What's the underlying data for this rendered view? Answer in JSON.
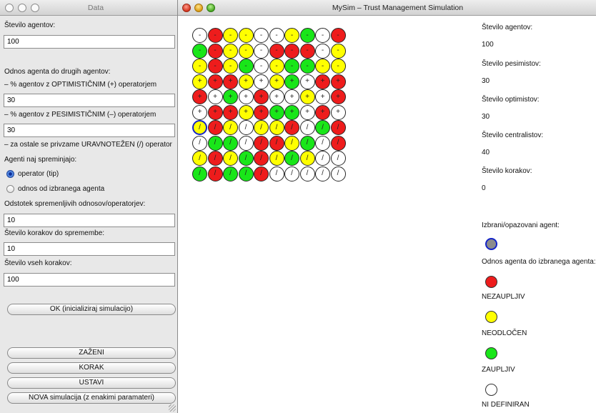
{
  "data_window": {
    "title": "Data",
    "agents_label": "Število agentov:",
    "agents_value": "100",
    "relation_label": "Odnos agenta do drugih agentov:",
    "optimistic_label": "– % agentov z OPTIMISTIČNIM (+) operatorjem",
    "optimistic_value": "30",
    "pessimistic_label": "– % agentov z PESIMISTIČNIM (–) operatorjem",
    "pessimistic_value": "30",
    "balanced_label": "– za ostale se privzame URAVNOTEŽEN (/) operator",
    "change_label": "Agenti naj spreminjajo:",
    "radio_operator": "operator (tip)",
    "radio_relation": "odnos od izbranega agenta",
    "percent_label": "Odstotek spremenljivih odnosov/operatorjev:",
    "percent_value": "10",
    "steps_change_label": "Število korakov do spremembe:",
    "steps_change_value": "10",
    "steps_total_label": "Število vseh korakov:",
    "steps_total_value": "100",
    "ok_button": "OK (inicializiraj simulacijo)",
    "run_button": "ZAŽENI",
    "step_button": "KORAK",
    "stop_button": "USTAVI",
    "new_button": "NOVA simulacija (z enakimi paramateri)"
  },
  "sim_window": {
    "title": "MySim – Trust Management Simulation",
    "grid": [
      [
        [
          "w",
          "-"
        ],
        [
          "r",
          "-"
        ],
        [
          "y",
          "-"
        ],
        [
          "y",
          "-"
        ],
        [
          "w",
          "-"
        ],
        [
          "w",
          "-"
        ],
        [
          "y",
          "-"
        ],
        [
          "g",
          "-"
        ],
        [
          "w",
          "-"
        ],
        [
          "r",
          "-"
        ]
      ],
      [
        [
          "g",
          "-"
        ],
        [
          "r",
          "-"
        ],
        [
          "y",
          "-"
        ],
        [
          "y",
          "-"
        ],
        [
          "w",
          "-"
        ],
        [
          "r",
          "-"
        ],
        [
          "r",
          "-"
        ],
        [
          "r",
          "-"
        ],
        [
          "w",
          "-"
        ],
        [
          "y",
          "-"
        ]
      ],
      [
        [
          "y",
          "-"
        ],
        [
          "r",
          "-"
        ],
        [
          "y",
          "-"
        ],
        [
          "g",
          "-"
        ],
        [
          "w",
          "-"
        ],
        [
          "y",
          "-"
        ],
        [
          "g",
          "-"
        ],
        [
          "g",
          "-"
        ],
        [
          "y",
          "-"
        ],
        [
          "y",
          "-"
        ]
      ],
      [
        [
          "y",
          "+"
        ],
        [
          "r",
          "+"
        ],
        [
          "r",
          "+"
        ],
        [
          "y",
          "+"
        ],
        [
          "w",
          "+"
        ],
        [
          "y",
          "+"
        ],
        [
          "g",
          "+"
        ],
        [
          "w",
          "+"
        ],
        [
          "r",
          "+"
        ],
        [
          "r",
          "+"
        ]
      ],
      [
        [
          "r",
          "+"
        ],
        [
          "w",
          "+"
        ],
        [
          "g",
          "+"
        ],
        [
          "w",
          "+"
        ],
        [
          "r",
          "+"
        ],
        [
          "w",
          "+"
        ],
        [
          "w",
          "+"
        ],
        [
          "y",
          "+"
        ],
        [
          "w",
          "+"
        ],
        [
          "r",
          "+"
        ]
      ],
      [
        [
          "w",
          "+"
        ],
        [
          "r",
          "+"
        ],
        [
          "r",
          "+"
        ],
        [
          "y",
          "+"
        ],
        [
          "r",
          "+"
        ],
        [
          "g",
          "+"
        ],
        [
          "g",
          "+"
        ],
        [
          "w",
          "+"
        ],
        [
          "r",
          "+"
        ],
        [
          "w",
          "+"
        ]
      ],
      [
        [
          "y",
          "/"
        ],
        [
          "r",
          "/"
        ],
        [
          "y",
          "/"
        ],
        [
          "w",
          "/"
        ],
        [
          "y",
          "/"
        ],
        [
          "y",
          "/"
        ],
        [
          "r",
          "/"
        ],
        [
          "w",
          "/"
        ],
        [
          "g",
          "/"
        ],
        [
          "r",
          "/"
        ]
      ],
      [
        [
          "w",
          "/"
        ],
        [
          "g",
          "/"
        ],
        [
          "g",
          "/"
        ],
        [
          "w",
          "/"
        ],
        [
          "r",
          "/"
        ],
        [
          "r",
          "/"
        ],
        [
          "y",
          "/"
        ],
        [
          "g",
          "/"
        ],
        [
          "w",
          "/"
        ],
        [
          "r",
          "/"
        ]
      ],
      [
        [
          "y",
          "/"
        ],
        [
          "r",
          "/"
        ],
        [
          "y",
          "/"
        ],
        [
          "g",
          "/"
        ],
        [
          "r",
          "/"
        ],
        [
          "y",
          "/"
        ],
        [
          "g",
          "/"
        ],
        [
          "y",
          "/"
        ],
        [
          "w",
          "/"
        ],
        [
          "w",
          "/"
        ]
      ],
      [
        [
          "g",
          "/"
        ],
        [
          "r",
          "/"
        ],
        [
          "g",
          "/"
        ],
        [
          "g",
          "/"
        ],
        [
          "r",
          "/"
        ],
        [
          "w",
          "/"
        ],
        [
          "w",
          "/"
        ],
        [
          "w",
          "/"
        ],
        [
          "w",
          "/"
        ],
        [
          "w",
          "/"
        ]
      ]
    ],
    "selected_agent": {
      "row": 6,
      "col": 0
    },
    "stats": {
      "agents_label": "Število agentov:",
      "agents_value": "100",
      "pessimists_label": "Število pesimistov:",
      "pessimists_value": "30",
      "optimists_label": "Število optimistov:",
      "optimists_value": "30",
      "centralists_label": "Število centralistov:",
      "centralists_value": "40",
      "steps_label": "Število korakov:",
      "steps_value": "0"
    },
    "legend": {
      "observed_label": "Izbrani/opazovani agent:",
      "relation_label": "Odnos agenta do izbranega agenta:",
      "distrust": "NEZAUPLJIV",
      "undecided": "NEODLOČEN",
      "trust": "ZAUPLJIV",
      "undefined": "NI DEFINIRAN"
    }
  },
  "colors": {
    "red": "#ee1c1c",
    "yellow": "#ffff00",
    "green": "#19e619",
    "white": "#ffffff",
    "selected_border": "#1424c8",
    "observed_fill": "#8c8c8c"
  }
}
